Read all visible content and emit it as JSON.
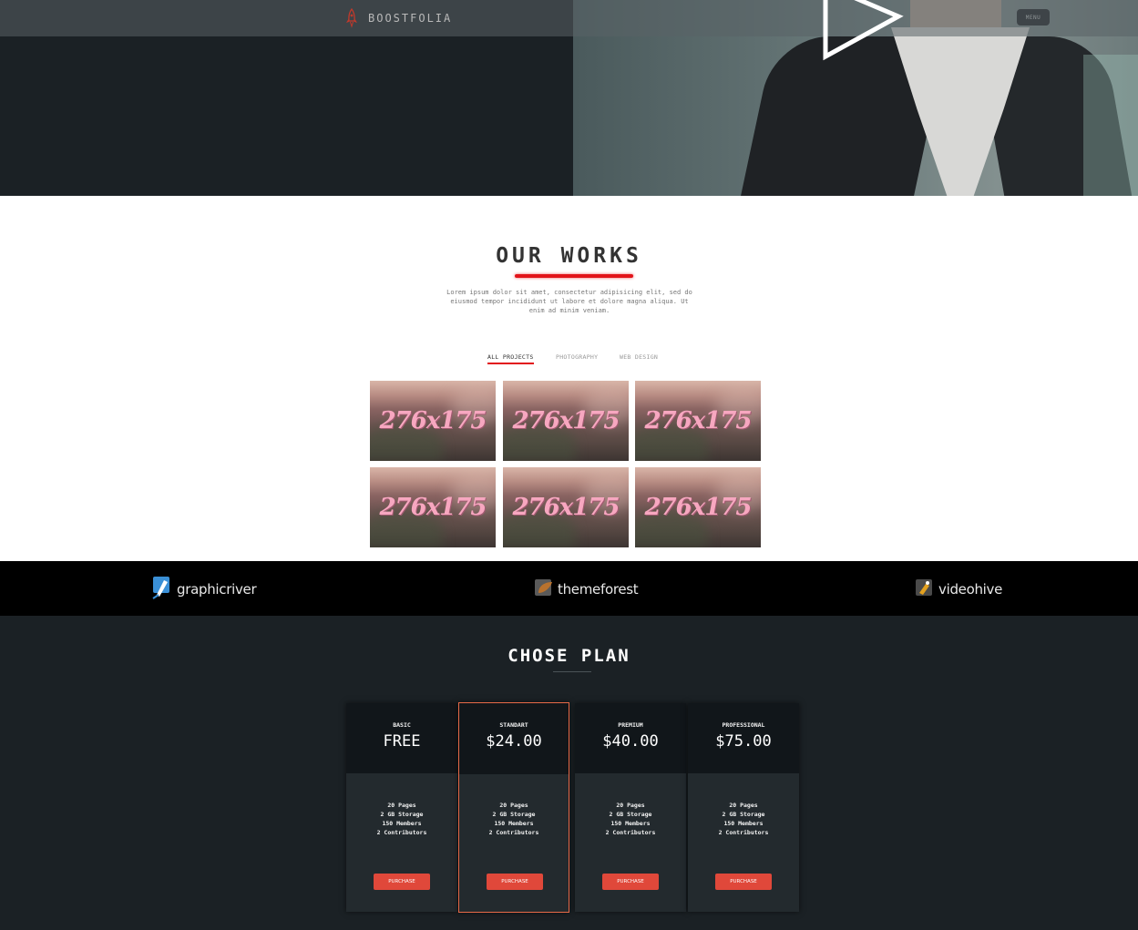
{
  "header": {
    "logo_text": "BOOSTFOLIA",
    "menu_label": "MENU"
  },
  "works": {
    "title": "OUR WORKS",
    "description": "Lorem ipsum dolor sit amet, consectetur adipisicing elit, sed do eiusmod tempor incididunt ut labore et dolore magna aliqua. Ut enim ad minim veniam.",
    "filters": [
      "ALL PROJECTS",
      "PHOTOGRAPHY",
      "WEB DESIGN"
    ],
    "active_filter": "ALL PROJECTS",
    "thumbnails": [
      "276x175",
      "276x175",
      "276x175",
      "276x175",
      "276x175",
      "276x175"
    ]
  },
  "partners": [
    "graphicriver",
    "themeforest",
    "videohive"
  ],
  "plans": {
    "title": "CHOSE PLAN",
    "items": [
      {
        "name": "BASIC",
        "price": "FREE",
        "features": [
          "20 Pages",
          "2 GB Storage",
          "150 Members",
          "2 Contributors"
        ],
        "button": "PURCHASE"
      },
      {
        "name": "STANDART",
        "price": "$24.00",
        "features": [
          "20 Pages",
          "2 GB Storage",
          "150 Members",
          "2 Contributors"
        ],
        "button": "PURCHASE"
      },
      {
        "name": "PREMIUM",
        "price": "$40.00",
        "features": [
          "20 Pages",
          "2 GB Storage",
          "150 Members",
          "2 Contributors"
        ],
        "button": "PURCHASE"
      },
      {
        "name": "PROFESSIONAL",
        "price": "$75.00",
        "features": [
          "20 Pages",
          "2 GB Storage",
          "150 Members",
          "2 Contributors"
        ],
        "button": "PURCHASE"
      }
    ],
    "featured_plan": "STANDART"
  },
  "colors": {
    "accent_red": "#e2141a",
    "button_red": "#e0483a",
    "featured_border": "#e86a48",
    "dark_bg": "#1b2125",
    "thumb_label": "#f7a7c0"
  },
  "icons": [
    "rocket-icon",
    "play-icon",
    "graphicriver-logo-icon",
    "themeforest-logo-icon",
    "videohive-logo-icon"
  ]
}
